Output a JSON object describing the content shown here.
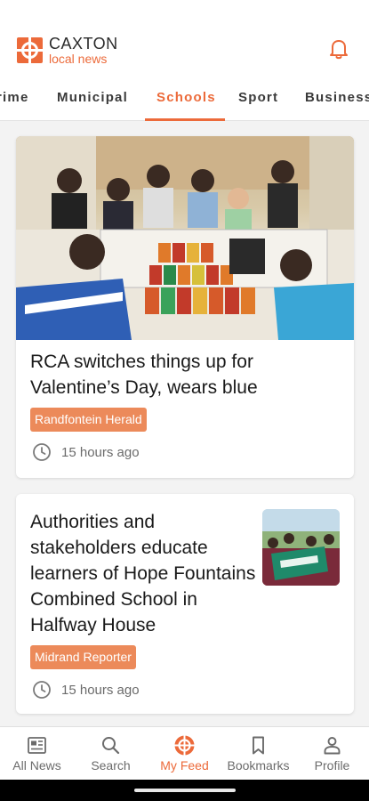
{
  "app": {
    "brand": "CAXTON",
    "sub_brand": "local news",
    "accent_color": "#ec6a3a",
    "notification_icon": "bell-icon"
  },
  "tabs": [
    {
      "label": "rime",
      "active": false
    },
    {
      "label": "Municipal",
      "active": false
    },
    {
      "label": "Schools",
      "active": true
    },
    {
      "label": "Sport",
      "active": false
    },
    {
      "label": "Business",
      "active": false
    }
  ],
  "articles": [
    {
      "headline": "RCA switches things up for Valentine’s Day, wears blue",
      "source": "Randfontein Herald",
      "time": "15 hours ago",
      "image": "classroom-food-drive-photo"
    },
    {
      "headline": "Authorities and stakeholders educate learners of Hope Fountains Combined School in Halfway House",
      "source": "Midrand Reporter",
      "time": "15 hours ago",
      "image": "learners-banner-photo"
    }
  ],
  "bottom_nav": [
    {
      "label": "All News",
      "icon": "newspaper-icon",
      "active": false
    },
    {
      "label": "Search",
      "icon": "search-icon",
      "active": false
    },
    {
      "label": "My Feed",
      "icon": "caxton-logo-icon",
      "active": true
    },
    {
      "label": "Bookmarks",
      "icon": "bookmark-icon",
      "active": false
    },
    {
      "label": "Profile",
      "icon": "profile-icon",
      "active": false
    }
  ]
}
